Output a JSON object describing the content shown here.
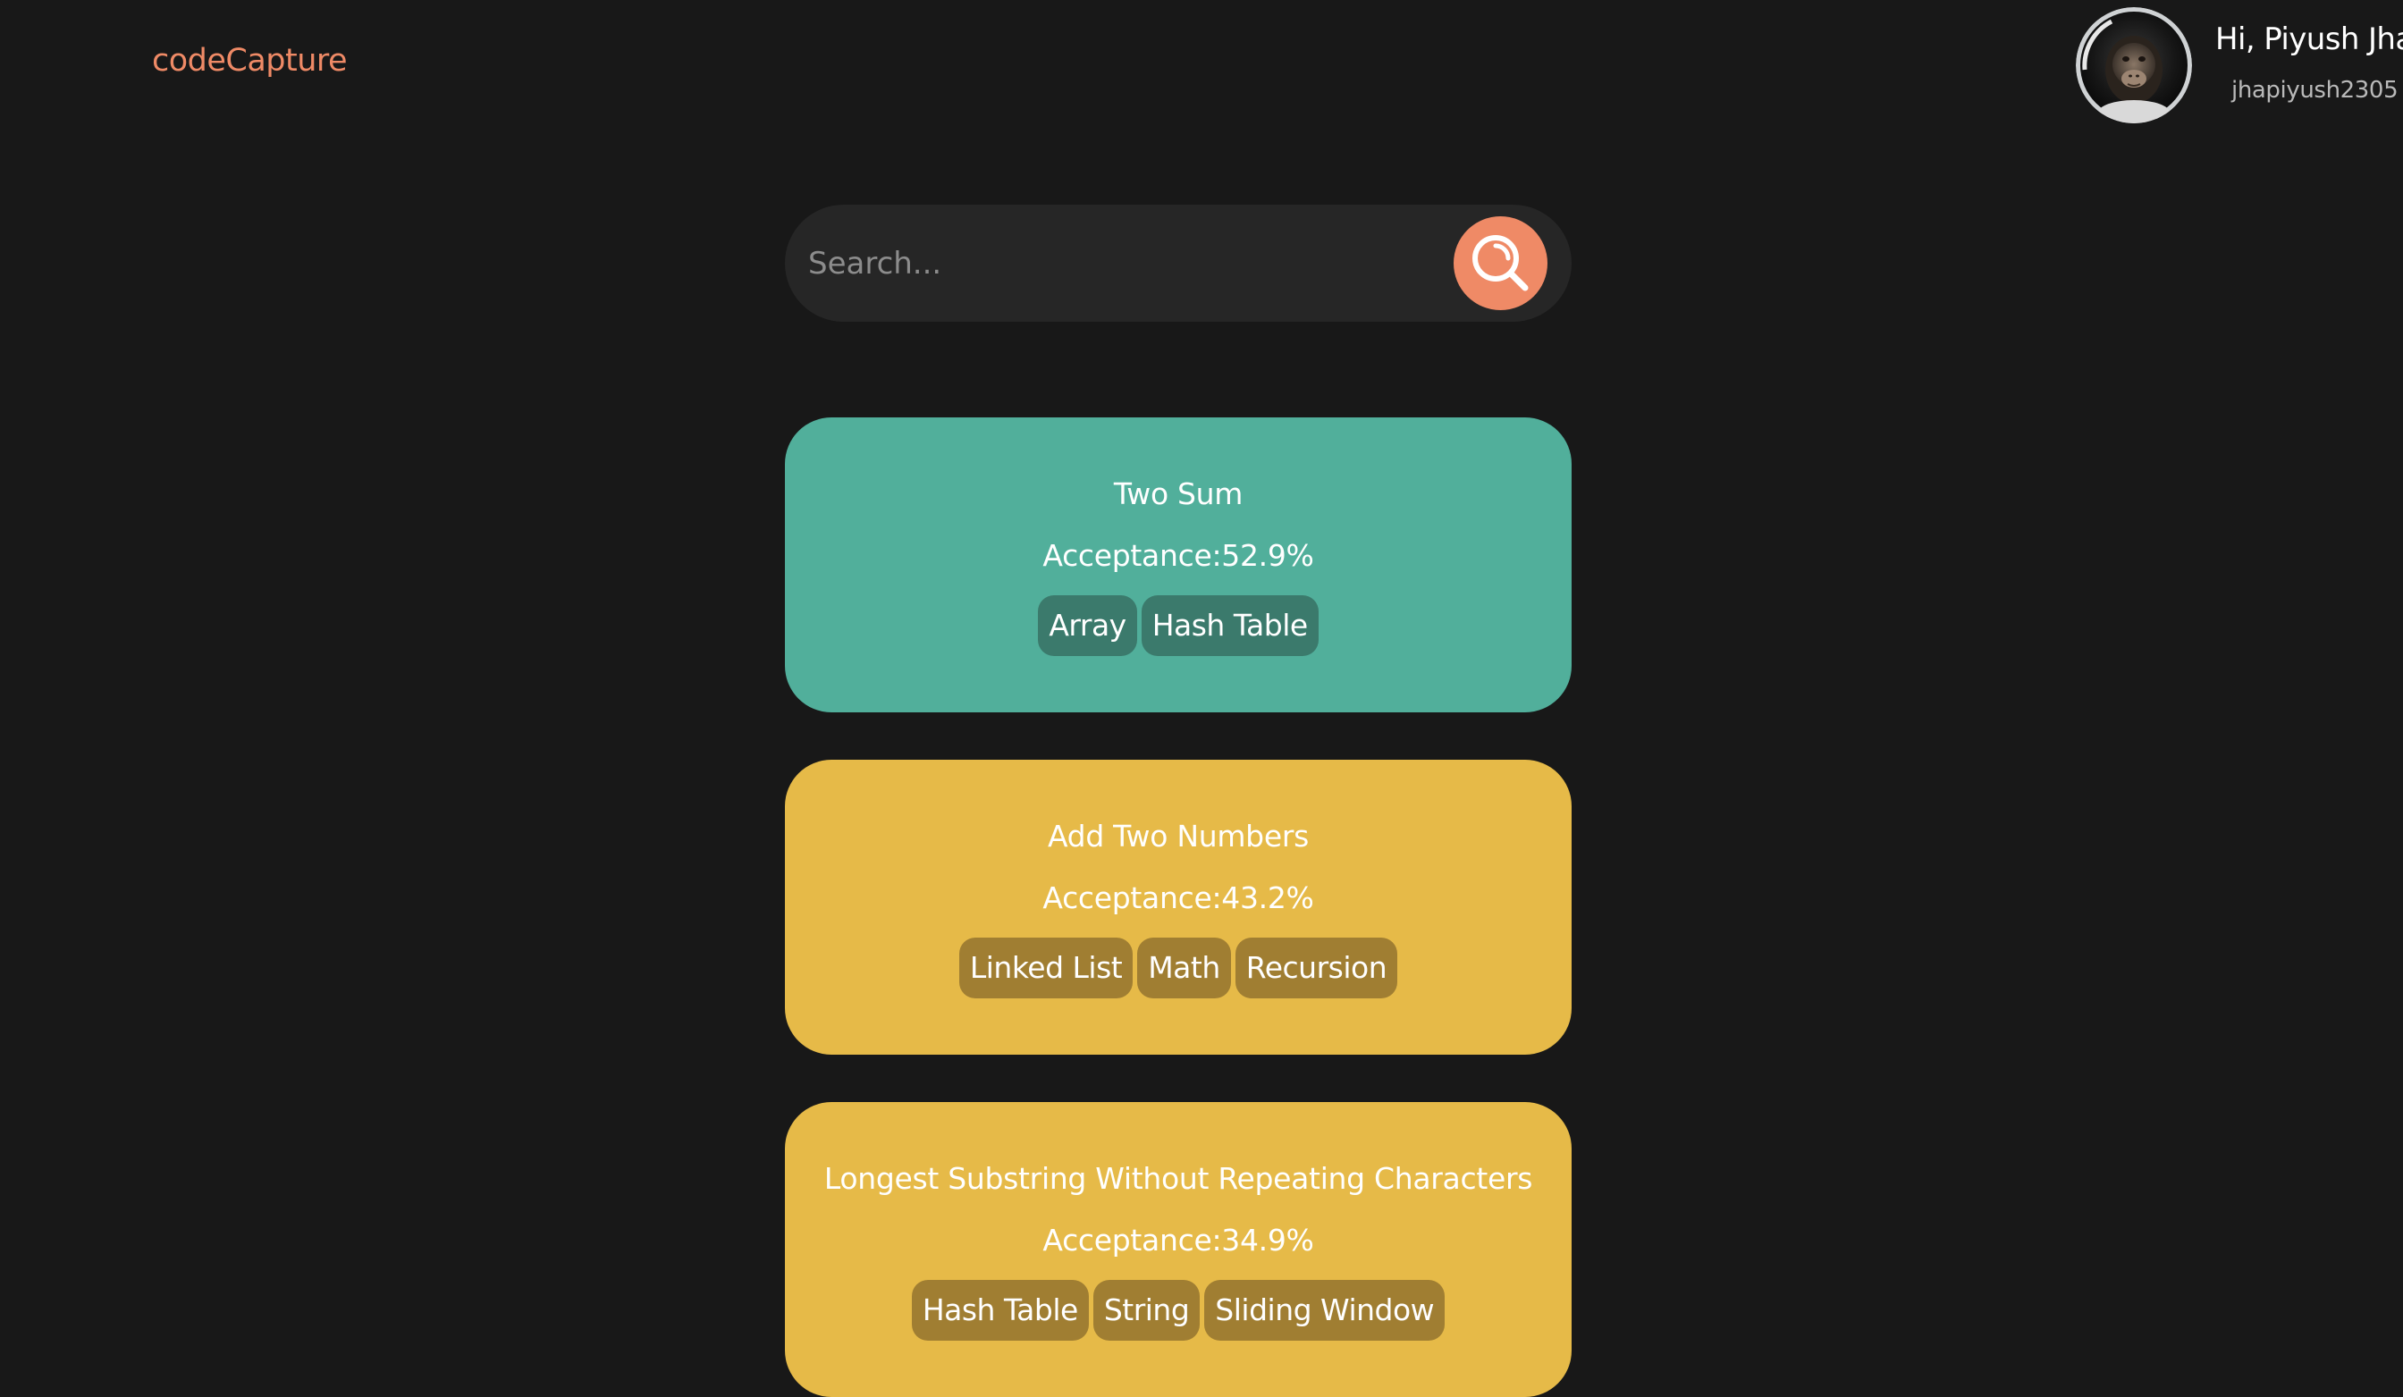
{
  "header": {
    "logo": "codeCapture",
    "greeting": "Hi, Piyush Jha",
    "username": "jhapiyush2305",
    "avatar_icon": "monkey-astronaut-avatar"
  },
  "search": {
    "placeholder": "Search...",
    "value": "",
    "button_icon": "search-icon"
  },
  "colors": {
    "background": "#181818",
    "accent": "#ef8a66",
    "easy_card": "#51af9b",
    "easy_tag": "#3b7a6c",
    "medium_card": "#e6ba48",
    "medium_tag": "#a07e32"
  },
  "problems": [
    {
      "title": "Two Sum",
      "acceptance": "Acceptance:52.9%",
      "tags": [
        "Array",
        "Hash Table"
      ],
      "difficulty_color": "#51af9b",
      "tag_color": "#3b7a6c"
    },
    {
      "title": "Add Two Numbers",
      "acceptance": "Acceptance:43.2%",
      "tags": [
        "Linked List",
        "Math",
        "Recursion"
      ],
      "difficulty_color": "#e6ba48",
      "tag_color": "#a07e32"
    },
    {
      "title": "Longest Substring Without Repeating Characters",
      "acceptance": "Acceptance:34.9%",
      "tags": [
        "Hash Table",
        "String",
        "Sliding Window"
      ],
      "difficulty_color": "#e6ba48",
      "tag_color": "#a07e32"
    }
  ]
}
